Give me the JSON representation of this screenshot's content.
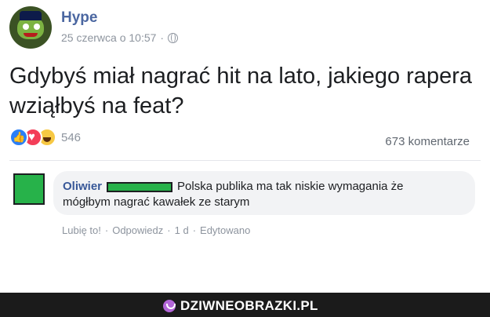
{
  "post": {
    "page_name": "Hype",
    "date": "25 czerwca o 10:57",
    "separator": "·",
    "text": "Gdybyś miał nagrać hit na lato, jakiego rapera wziąłbyś na feat?",
    "reaction_count": "546",
    "comments_count": "673 komentarze"
  },
  "comment": {
    "author": "Oliwier",
    "text_line1": "Polska publika ma tak niskie wymagania że",
    "text_line2": "mógłbym nagrać kawałek ze starym",
    "actions": {
      "like": "Lubię to!",
      "reply": "Odpowiedz",
      "time": "1 d",
      "edited": "Edytowano",
      "dot": "·"
    }
  },
  "footer": {
    "brand": "DZIWNEOBRAZKI.PL"
  },
  "colors": {
    "link_blue": "#385898",
    "page_name_blue": "#4b67a1",
    "censor_green": "#27b24a",
    "footer_bg": "#1b1b1b"
  }
}
